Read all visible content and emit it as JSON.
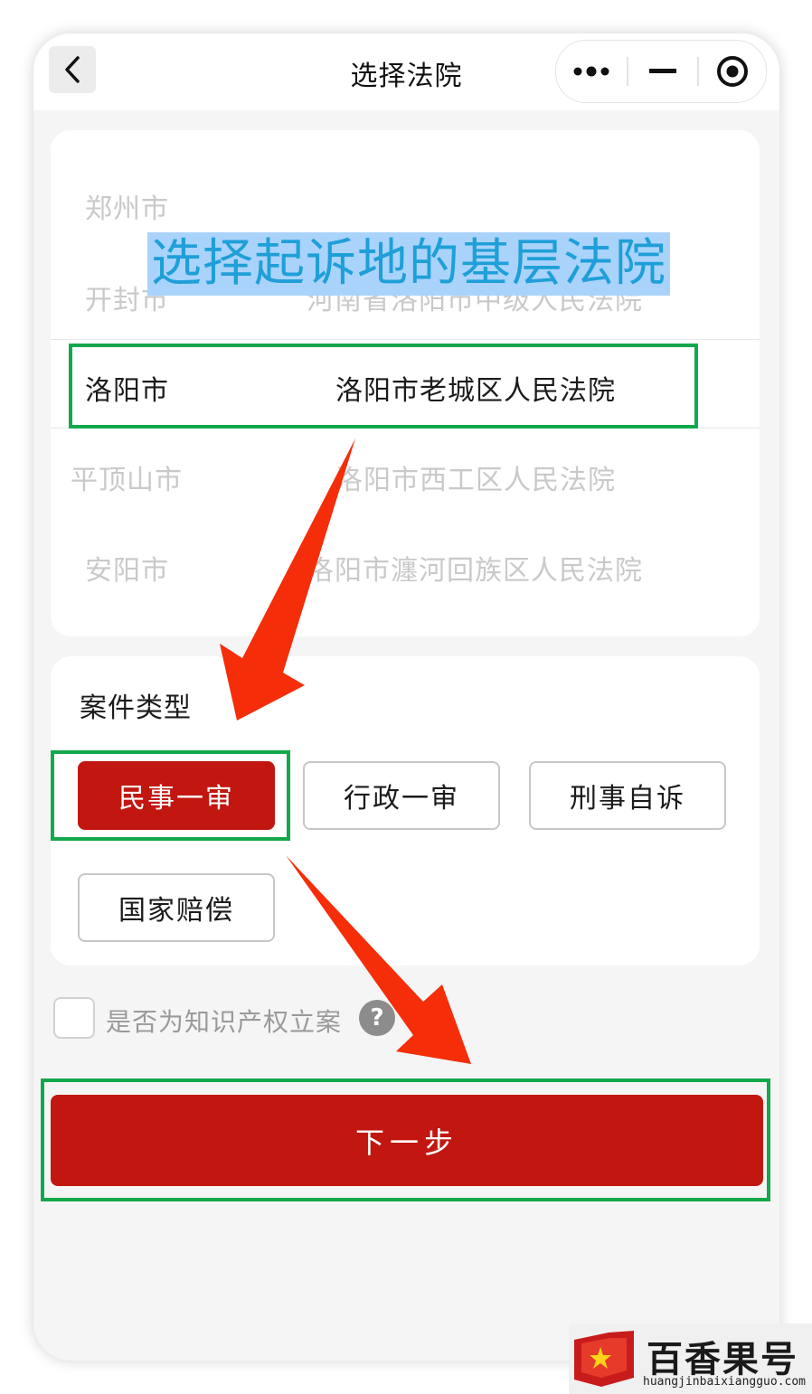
{
  "header": {
    "title": "选择法院"
  },
  "picker": {
    "cities": [
      "郑州市",
      "开封市",
      "洛阳市",
      "平顶山市",
      "安阳市"
    ],
    "courts": [
      "河南省洛阳市中级人民法院",
      "洛阳市老城区人民法院",
      "洛阳市西工区人民法院",
      "洛阳市瀍河回族区人民法院"
    ],
    "selected_city": "洛阳市",
    "selected_court": "洛阳市老城区人民法院"
  },
  "overlay": {
    "label": "选择起诉地的基层法院"
  },
  "case_type": {
    "title": "案件类型",
    "options": [
      "民事一审",
      "行政一审",
      "刑事自诉",
      "国家赔偿"
    ],
    "selected": "民事一审"
  },
  "ip_checkbox": {
    "label": "是否为知识产权立案",
    "help_icon": "?",
    "checked": false
  },
  "next_button": {
    "label": "下一步"
  },
  "watermark": {
    "name": "百香果号",
    "url": "huangjinbaixiangguo.com"
  },
  "colors": {
    "primary": "#c21711",
    "highlight_box": "#13a84b",
    "arrow": "#f52d09",
    "overlay_bg": "#a9d3fb",
    "overlay_text": "#1f9fd8"
  }
}
